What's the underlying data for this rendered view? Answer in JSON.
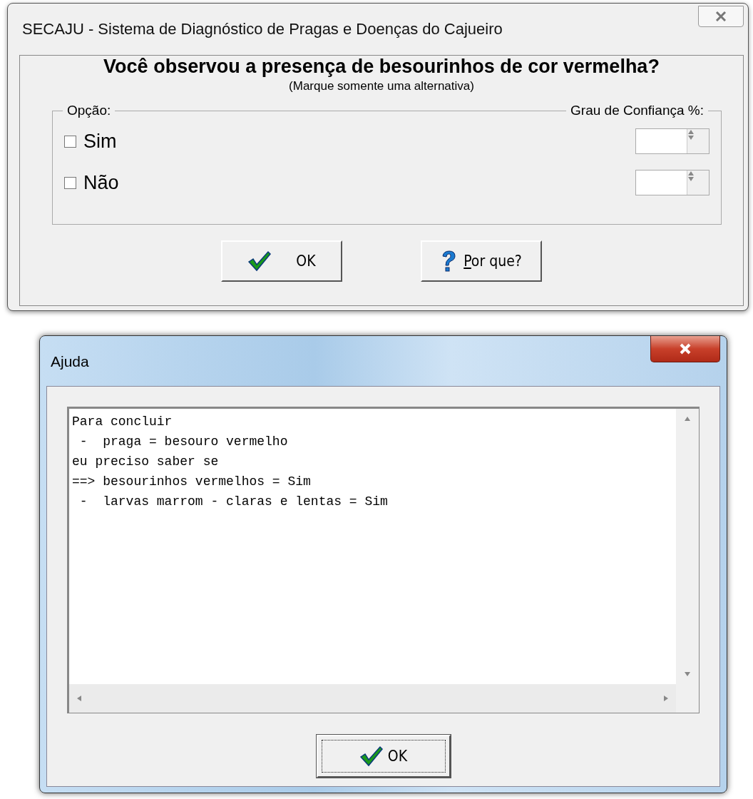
{
  "main_window": {
    "title": "SECAJU - Sistema de Diagnóstico de Pragas e Doenças do Cajueiro",
    "question": "Você observou a presença de besourinhos de cor vermelha?",
    "instruction": "(Marque somente uma alternativa)",
    "options_label": "Opção:",
    "confidence_label": "Grau de Confiança %:",
    "options": [
      {
        "label": "Sim",
        "checked": false
      },
      {
        "label": "Não",
        "checked": false
      }
    ],
    "buttons": [
      {
        "label": "OK",
        "kind": "check"
      },
      {
        "label": "Por que?",
        "kind": "help"
      }
    ]
  },
  "help_window": {
    "title": "Ajuda",
    "lines": [
      "Para concluir",
      " -  praga = besouro vermelho",
      "eu preciso saber se",
      "==> besourinhos vermelhos = Sim",
      " -  larvas marrom - claras e lentas = Sim"
    ],
    "button": {
      "label": "OK"
    }
  }
}
